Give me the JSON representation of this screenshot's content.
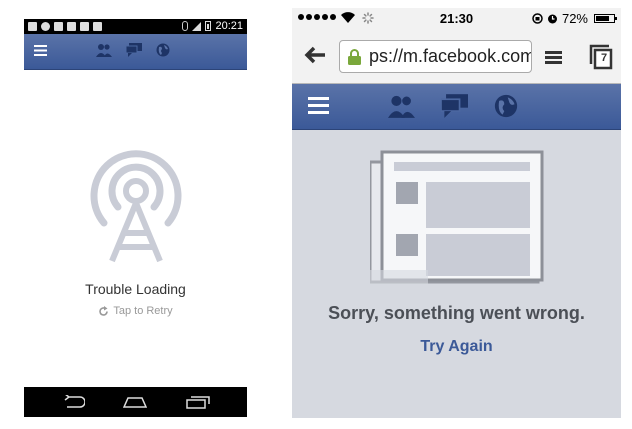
{
  "android": {
    "status_time": "20:21",
    "title": "Trouble Loading",
    "retry": "Tap to Retry",
    "nav_icons": [
      "friends-icon",
      "messages-icon",
      "globe-icon"
    ],
    "bottom_buttons": [
      "back-icon",
      "home-icon",
      "recents-icon"
    ]
  },
  "ios": {
    "status_time": "21:30",
    "battery": "72%",
    "url": "ps://m.facebook.com",
    "tabs_count": "7",
    "message": "Sorry, something went wrong.",
    "try_again": "Try Again",
    "nav_icons": [
      "friends-icon",
      "messages-icon",
      "globe-icon"
    ]
  },
  "colors": {
    "facebook_blue": "#3b5998",
    "error_background": "#d6d9e0",
    "illustration_gray": "#c9ccd6"
  }
}
